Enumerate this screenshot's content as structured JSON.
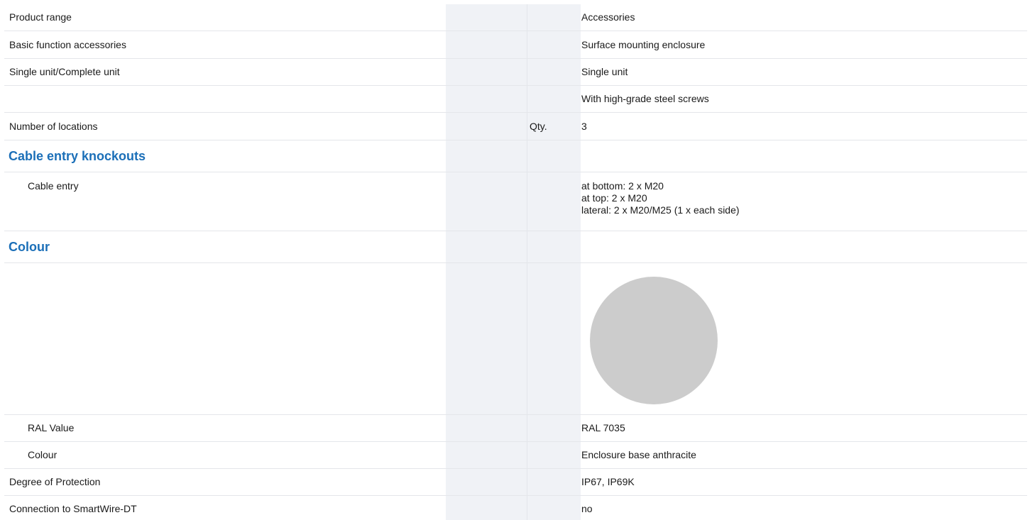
{
  "rows": [
    {
      "label": "Product range",
      "unit": "",
      "value": "Accessories"
    },
    {
      "label": "Basic function accessories",
      "unit": "",
      "value": "Surface mounting enclosure"
    },
    {
      "label": "Single unit/Complete unit",
      "unit": "",
      "value": "Single unit"
    },
    {
      "label": "",
      "unit": "",
      "value": "With high-grade steel screws"
    },
    {
      "label": "Number of locations",
      "unit": "Qty.",
      "value": "3"
    }
  ],
  "cable_entry": {
    "heading": "Cable entry knockouts",
    "label": "Cable entry",
    "lines": [
      "at bottom: 2 x M20",
      "at top: 2 x M20",
      "lateral: 2 x M20/M25 (1 x each side)"
    ]
  },
  "colour_section": {
    "heading": "Colour",
    "swatch_color": "#cccccc",
    "ral_label": "RAL Value",
    "ral_value": "RAL 7035",
    "colour_label": "Colour",
    "colour_value": "Enclosure base anthracite"
  },
  "bottom_rows": [
    {
      "label": "Degree of Protection",
      "value": "IP67, IP69K"
    },
    {
      "label": "Connection to SmartWire-DT",
      "value": "no"
    }
  ],
  "colors": {
    "heading": "#1b6fb8",
    "shaded_column": "#f0f2f6",
    "row_border": "#e4e6ea"
  }
}
